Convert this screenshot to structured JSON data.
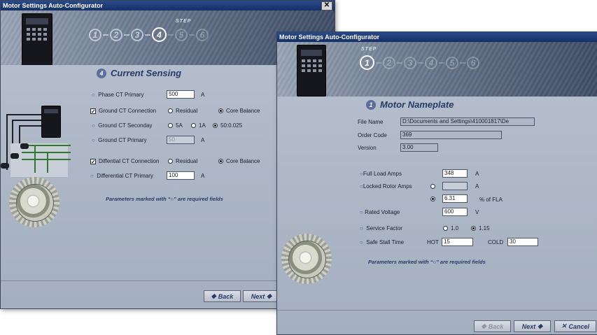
{
  "back_window": {
    "title": "Motor Settings Auto-Configurator",
    "step_label": "STEP",
    "steps": [
      "1",
      "2",
      "3",
      "4",
      "5",
      "6"
    ],
    "active_step": "4",
    "section_number": "4",
    "section_title": "Current Sensing",
    "phase_ct_primary": {
      "label": "Phase CT Primary",
      "value": "500",
      "unit": "A"
    },
    "ground_ct_connection": {
      "label": "Ground CT Connection",
      "checked": true,
      "opt1": "Residual",
      "opt2": "Core Balance"
    },
    "ground_ct_secondary": {
      "label": "Ground CT Seconday",
      "opt1": "5A",
      "opt2": "1A",
      "opt3": "50:0.025"
    },
    "ground_ct_primary": {
      "label": "Ground CT Primary",
      "value": "50",
      "unit": "A"
    },
    "diff_ct_connection": {
      "label": "Diffential CT Connection",
      "checked": true,
      "opt1": "Residual",
      "opt2": "Core Balance"
    },
    "diff_ct_primary": {
      "label": "Differential CT Primary",
      "value": "100",
      "unit": "A"
    },
    "note_prefix": "Parameters marked with “",
    "note_symbol": "○",
    "note_suffix": "” are required fields",
    "back_button": "Back",
    "next_button": "Next"
  },
  "front_window": {
    "title": "Motor Settings Auto-Configurator",
    "step_label": "STEP",
    "steps": [
      "1",
      "2",
      "3",
      "4",
      "5",
      "6"
    ],
    "active_step": "1",
    "section_number": "1",
    "section_title": "Motor Nameplate",
    "file_name": {
      "label": "File Name",
      "value": "D:\\Documents and Settings\\410001817\\De"
    },
    "order_code": {
      "label": "Order Code",
      "value": "369"
    },
    "version": {
      "label": "Version",
      "value": "3.00"
    },
    "full_load_amps": {
      "label": "Full Load Amps",
      "value": "348",
      "unit": "A"
    },
    "locked_rotor_amps": {
      "label": "Locked Rotor Amps",
      "value_a": "",
      "unit_a": "A",
      "value_pct": "6.31",
      "unit_pct": "% of FLA"
    },
    "rated_voltage": {
      "label": "Rated Voltage",
      "value": "600",
      "unit": "V"
    },
    "service_factor": {
      "label": "Service Factor",
      "opt1": "1.0",
      "opt2": "1.15"
    },
    "safe_stall_time": {
      "label": "Safe Stall Time",
      "hot_label": "HOT",
      "hot_value": "15",
      "cold_label": "COLD",
      "cold_value": "30"
    },
    "note_prefix": "Parameters marked with “",
    "note_symbol": "○",
    "note_suffix": "” are required fields",
    "back_button": "Back",
    "next_button": "Next",
    "cancel_button": "Cancel"
  },
  "colors": {
    "titlebar": "#153066",
    "accent": "#2a3a66",
    "panel": "#aab5c4"
  },
  "icons": [
    "close-icon",
    "back-arrow-icon",
    "next-arrow-icon",
    "cancel-x-icon",
    "relay-device-icon",
    "motor-icon",
    "required-marker-icon"
  ]
}
